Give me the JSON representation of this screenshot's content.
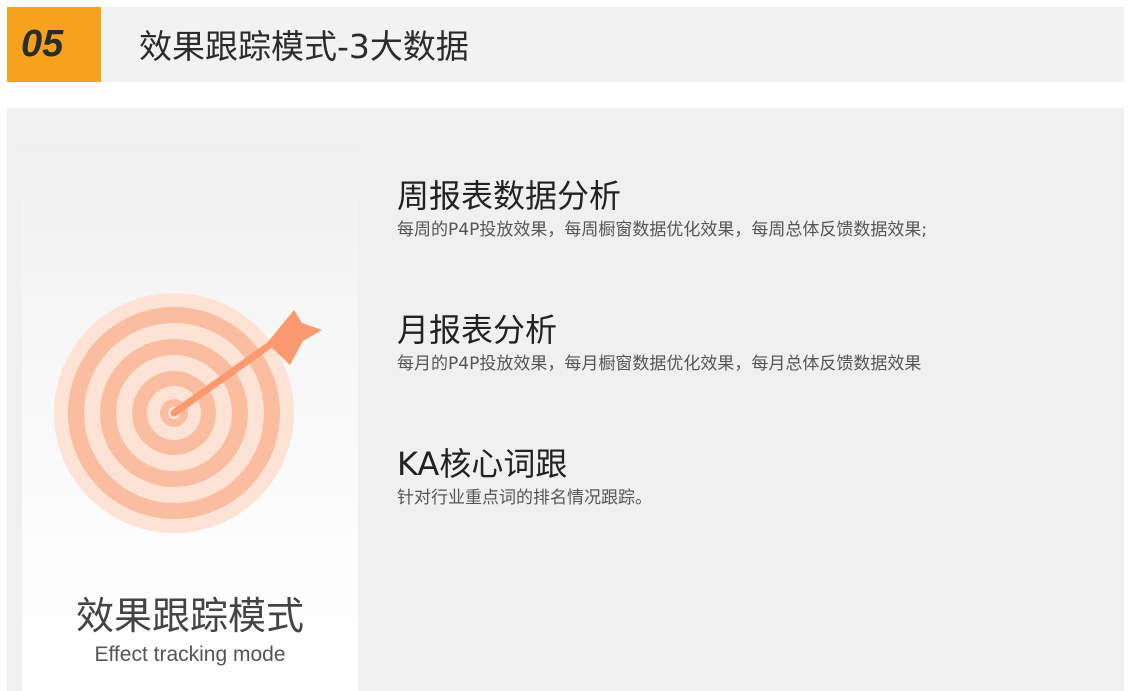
{
  "header": {
    "number": "05",
    "title": "效果跟踪模式-3大数据"
  },
  "card": {
    "icon": "target-arrow-icon",
    "title": "效果跟踪模式",
    "subtitle": "Effect tracking mode"
  },
  "features": [
    {
      "title": "周报表数据分析",
      "description": "每周的P4P投放效果，每周橱窗数据优化效果，每周总体反馈数据效果;"
    },
    {
      "title": "月报表分析",
      "description": "每月的P4P投放效果，每月橱窗数据优化效果，每月总体反馈数据效果"
    },
    {
      "title": "KA核心词跟",
      "description": "针对行业重点词的排名情况跟踪。"
    }
  ],
  "colors": {
    "accent": "#f7a21d",
    "target_light": "#fde3d6",
    "target_mid": "#fbbd9f",
    "target_dark": "#fb9a6e"
  }
}
